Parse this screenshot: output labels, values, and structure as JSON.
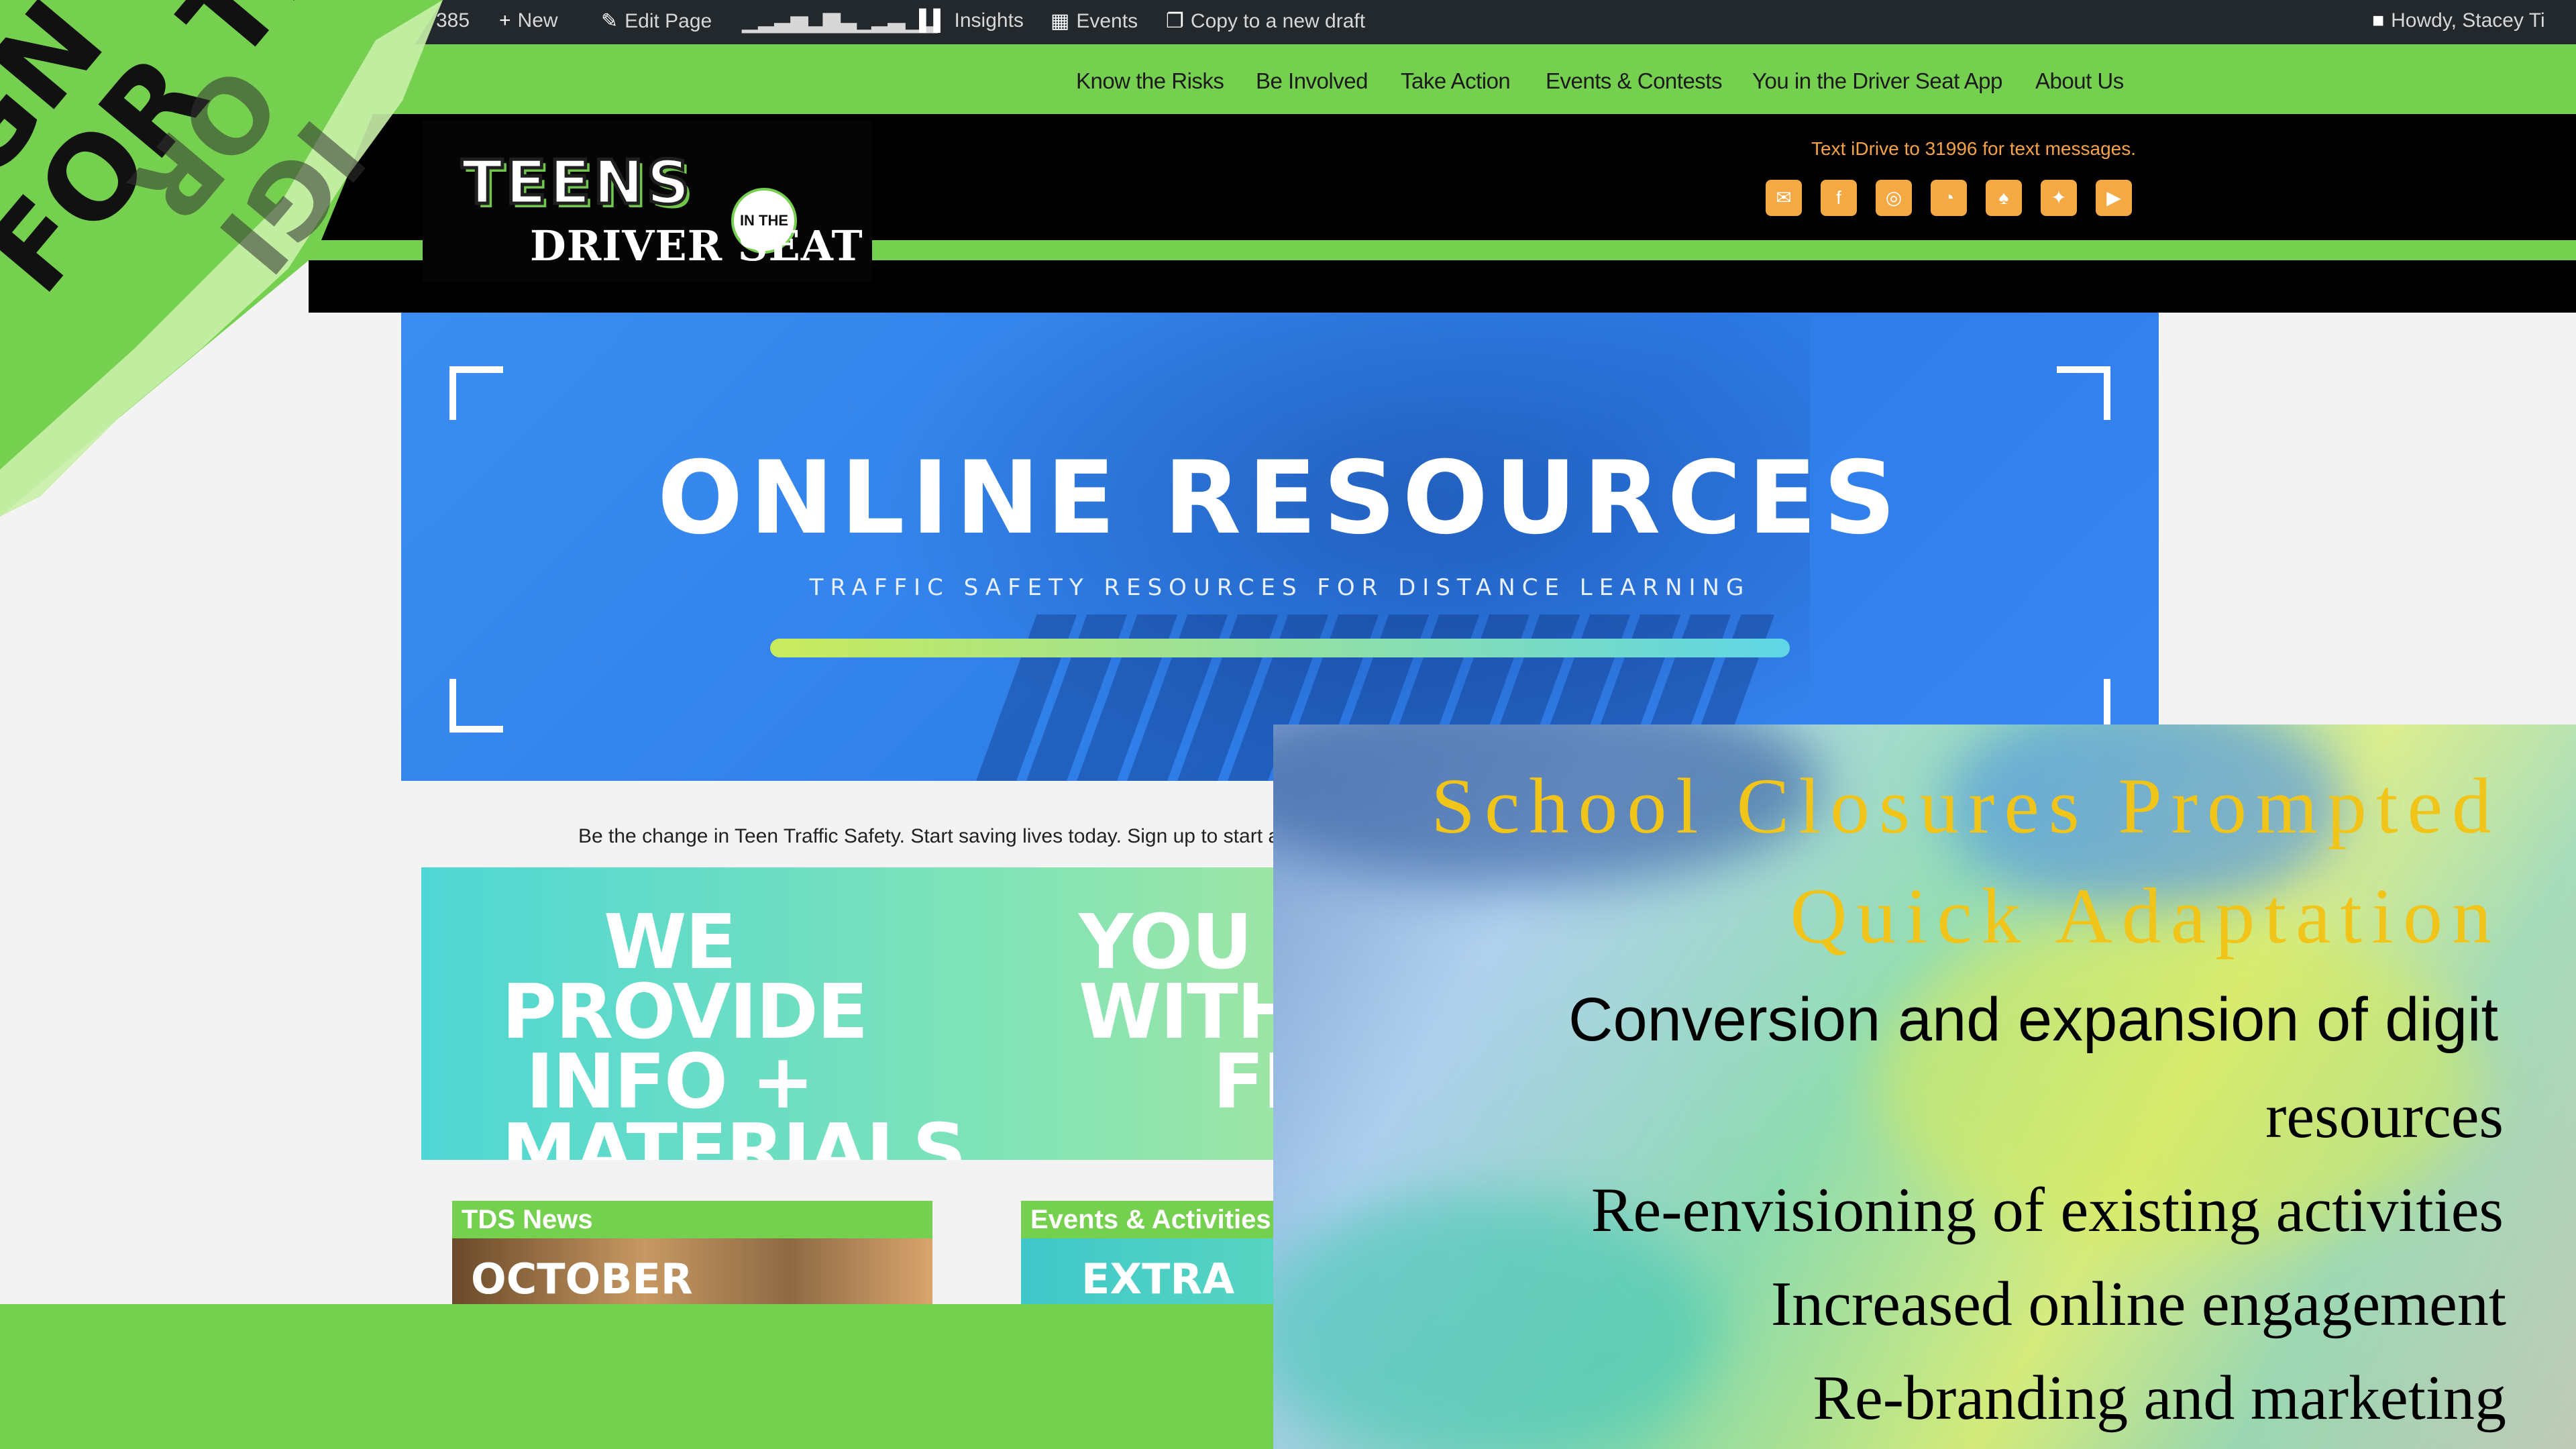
{
  "admin_bar": {
    "count": "385",
    "new": "New",
    "edit_page": "Edit Page",
    "insights": "Insights",
    "events": "Events",
    "copy_draft": "Copy to a new draft",
    "howdy": "Howdy, Stacey Ti"
  },
  "nav": {
    "items": [
      "Know the Risks",
      "Be Involved",
      "Take Action",
      "Events & Contests",
      "You in the Driver Seat App",
      "About Us"
    ]
  },
  "logo": {
    "teens": "TEENS",
    "in_the": "IN THE",
    "driver_seat": "DRIVER SEAT"
  },
  "header": {
    "text_message": "Text iDrive to 31996 for text messages."
  },
  "social_icons": [
    "email-icon",
    "facebook-icon",
    "instagram-icon",
    "rss-icon",
    "snapchat-icon",
    "twitter-icon",
    "youtube-icon"
  ],
  "banner": {
    "title": "ONLINE RESOURCES",
    "subtitle": "TRAFFIC SAFETY RESOURCES FOR DISTANCE LEARNING"
  },
  "tagline": "Be the change in Teen Traffic Safety. Start saving lives today. Sign up to start a Teen",
  "promo": {
    "left": [
      "WE PROVIDE",
      "INFO +",
      "MATERIALS"
    ],
    "right": [
      "YOU S",
      "WITH",
      "FRIE"
    ]
  },
  "cards": [
    {
      "head": "TDS News",
      "body": "OCTOBER"
    },
    {
      "head": "Events & Activities",
      "body": "EXTRA M"
    }
  ],
  "corner_sticker": {
    "line1": "IGN UP",
    "line2": "FOR TDS!",
    "back1": "IGI",
    "back2": "OR"
  },
  "slide": {
    "title_line1": "School Closures Prompted",
    "title_line2": "Quick Adaptation",
    "bullet1a": "Conversion and expansion of digit",
    "bullet1b": "resources",
    "bullet2": "Re-envisioning of existing activities",
    "bullet3": "Increased online engagement",
    "bullet4": "Re-branding and marketing"
  },
  "colors": {
    "brand_green": "#76d04f",
    "banner_blue": "#2d7ce8",
    "accent_orange": "#f5a945",
    "slide_title_gold": "#f0c419"
  }
}
